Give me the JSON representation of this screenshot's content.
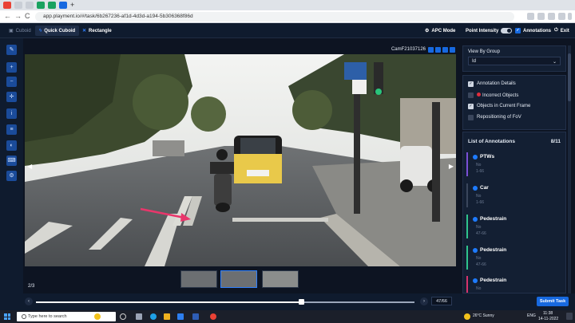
{
  "browser": {
    "url": "app.playment.io/#/task/6b267236-af1d-4d3d-a194-5b306368f86d",
    "nav": {
      "back": "←",
      "forward": "→",
      "reload": "C"
    }
  },
  "toolbar": {
    "cuboid_label": "Cuboid",
    "quick_cuboid_label": "Quick Cuboid",
    "rectangle_label": "Rectangle",
    "apc_mode_label": "APC Mode",
    "point_intensity_label": "Point Intensity",
    "annotations_label": "Annotations",
    "exit_label": "Exit"
  },
  "viewer": {
    "camera_label": "CamF21037126",
    "page_counter": "2/3",
    "thumbnails": [
      {
        "label": "",
        "selected": false
      },
      {
        "label": "",
        "selected": true
      },
      {
        "label": "",
        "selected": false
      }
    ]
  },
  "panel": {
    "view_by_group_label": "View By Group",
    "group_value": "Id",
    "options": [
      {
        "label": "Annotation Details",
        "checked": true
      },
      {
        "label": "Incorrect Objects",
        "checked": false
      },
      {
        "label": "Objects in Current Frame",
        "checked": true
      },
      {
        "label": "Repositioning of FoV",
        "checked": false
      }
    ],
    "annotations_title": "List of Annotations",
    "annotations_count": "8/11",
    "annotations": [
      {
        "title": "PTWs",
        "line1": "No",
        "line2": "1-66",
        "color": "#7b4fd6"
      },
      {
        "title": "Car",
        "line1": "No",
        "line2": "1-66",
        "color": "#3a465c"
      },
      {
        "title": "Pedestrain",
        "line1": "No",
        "line2": "47-66",
        "color": "#2fc48d"
      },
      {
        "title": "Pedestrain",
        "line1": "No",
        "line2": "47-66",
        "color": "#2fc48d"
      },
      {
        "title": "Pedestrain",
        "line1": "No",
        "line2": "",
        "color": "#d6336c"
      }
    ]
  },
  "timeline": {
    "progress_fraction": 0.7,
    "frame_label": "47/66",
    "submit_label": "Submit Task"
  },
  "taskbar": {
    "search_placeholder": "Type here to search",
    "weather": "26°C  Sunny",
    "lang": "ENG",
    "time": "11:38",
    "date": "14-11-2022"
  },
  "colors": {
    "accent": "#1769e0",
    "background": "#0d1422",
    "arrow": "#e8366b"
  },
  "icons": [
    "pencil-icon",
    "zoom-in-icon",
    "zoom-out-icon",
    "crosshair-icon",
    "info-icon",
    "layers-icon",
    "contrast-icon",
    "keyboard-icon",
    "settings-icon"
  ]
}
